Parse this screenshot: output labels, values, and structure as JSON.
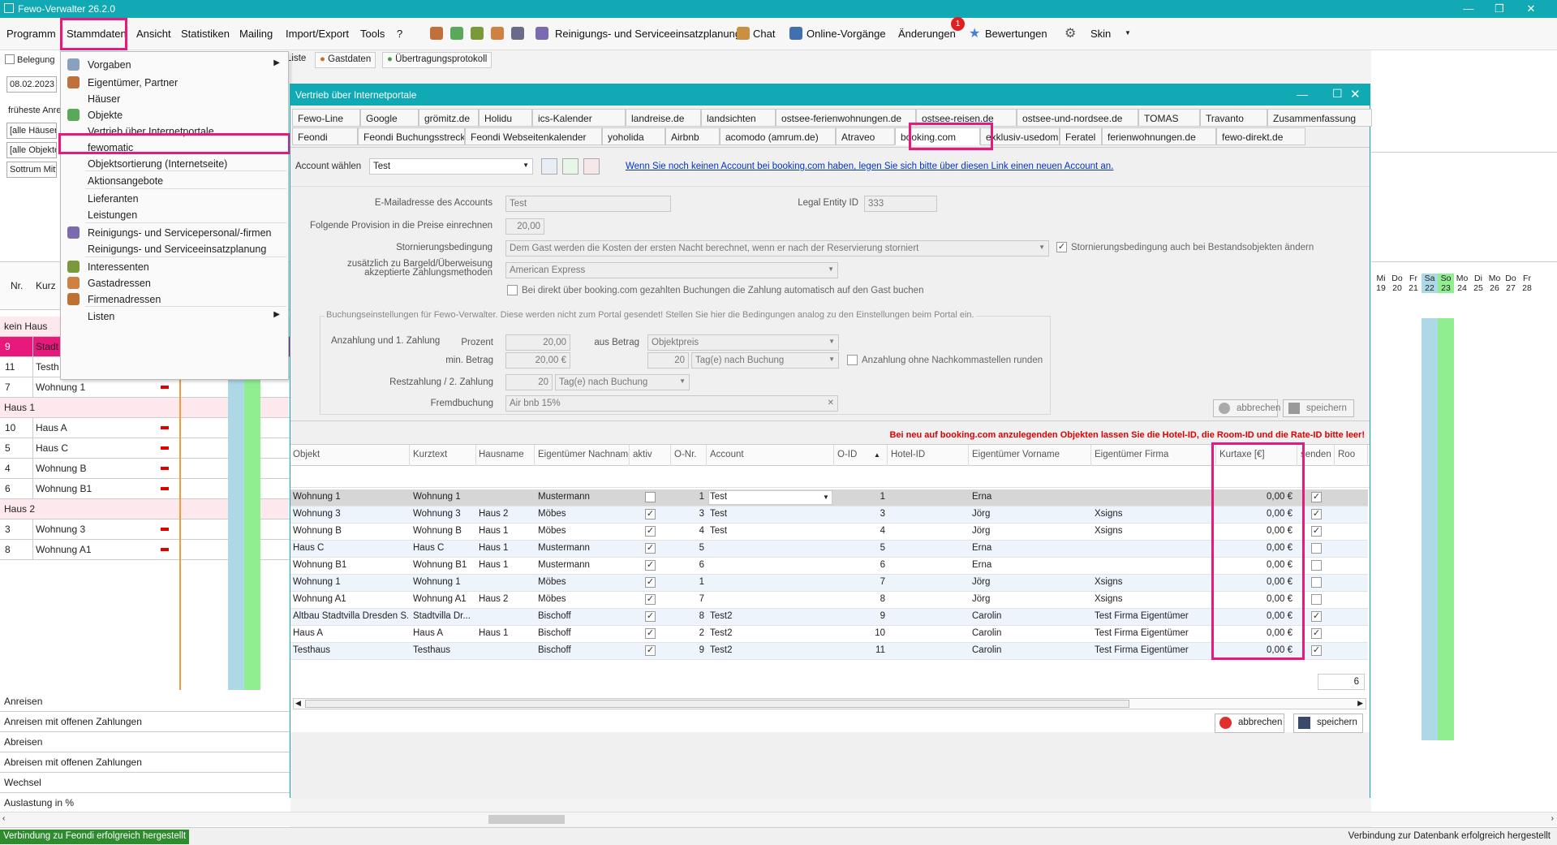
{
  "app": {
    "title": "Fewo-Verwalter 26.2.0"
  },
  "menu": {
    "items": [
      "Programm",
      "Stammdaten",
      "Ansicht",
      "Statistiken",
      "Mailing",
      "Import/Export",
      "Tools",
      "?"
    ],
    "toolbar": {
      "planning": "Reinigungs- und Serviceeinsatzplanung",
      "chat": "Chat",
      "online": "Online-Vorgänge",
      "changes": "Änderungen",
      "changes_badge": "1",
      "reviews": "Bewertungen",
      "skin": "Skin"
    }
  },
  "dropdown": {
    "items": [
      {
        "label": "Vorgaben",
        "arrow": true
      },
      {
        "label": "Eigentümer, Partner"
      },
      {
        "label": "Häuser"
      },
      {
        "label": "Objekte"
      },
      {
        "label": "Vertrieb über Internetportale"
      },
      {
        "label": "fewomatic"
      },
      {
        "label": "Objektsortierung (Internetseite)"
      },
      {
        "label": "Aktionsangebote"
      },
      {
        "label": "Lieferanten"
      },
      {
        "label": "Leistungen"
      },
      {
        "label": "Reinigungs- und Servicepersonal/-firmen"
      },
      {
        "label": "Reinigungs- und Serviceeinsatzplanung"
      },
      {
        "label": "Interessenten"
      },
      {
        "label": "Gastadressen"
      },
      {
        "label": "Firmenadressen"
      },
      {
        "label": "Listen",
        "arrow": true
      }
    ]
  },
  "left": {
    "tab": "Belegung",
    "date": "08.02.2023",
    "earliest": "früheste Anre",
    "filter1": "[alle Häuser]",
    "filter2": "[alle Objekte]",
    "filter3": "Sottrum Mitte",
    "col_nr": "Nr.",
    "col_kurz": "Kurz",
    "rows": [
      {
        "type": "group",
        "label": "kein Haus"
      },
      {
        "type": "item",
        "nr": "9",
        "kurz": "Stadt",
        "hl": true
      },
      {
        "type": "item",
        "nr": "11",
        "kurz": "Testh"
      },
      {
        "type": "item",
        "nr": "7",
        "kurz": "Wohnung 1"
      },
      {
        "type": "group",
        "label": "Haus 1"
      },
      {
        "type": "item",
        "nr": "10",
        "kurz": "Haus A"
      },
      {
        "type": "item",
        "nr": "5",
        "kurz": "Haus C"
      },
      {
        "type": "item",
        "nr": "4",
        "kurz": "Wohnung B"
      },
      {
        "type": "item",
        "nr": "6",
        "kurz": "Wohnung B1"
      },
      {
        "type": "group",
        "label": "Haus 2"
      },
      {
        "type": "item",
        "nr": "3",
        "kurz": "Wohnung 3"
      },
      {
        "type": "item",
        "nr": "8",
        "kurz": "Wohnung A1"
      }
    ],
    "summary": [
      "Anreisen",
      "Anreisen mit offenen Zahlungen",
      "Abreisen",
      "Abreisen mit offenen Zahlungen",
      "Wechsel",
      "Auslastung in %"
    ]
  },
  "bgtabs": [
    "Liste",
    "Gastdaten",
    "Übertragungsprotokoll"
  ],
  "calendar": {
    "days": [
      "Mi",
      "Do",
      "Fr",
      "Sa",
      "So",
      "Mo",
      "Di",
      "Mo",
      "Do",
      "Fr"
    ],
    "dates": [
      "19",
      "20",
      "21",
      "22",
      "23",
      "24",
      "25",
      "26",
      "27",
      "28"
    ]
  },
  "dialog": {
    "title": "Vertrieb über Internetportale",
    "tabs_row1": [
      "Fewo-Line",
      "Google",
      "grömitz.de",
      "Holidu",
      "ics-Kalender",
      "landreise.de",
      "landsichten",
      "ostsee-ferienwohnungen.de",
      "ostsee-reisen.de",
      "ostsee-und-nordsee.de",
      "TOMAS",
      "Travanto",
      "Zusammenfassung"
    ],
    "tabs_row2": [
      "Feondi",
      "Feondi Buchungsstrecke",
      "Feondi Webseitenkalender",
      "yoholida",
      "Airbnb",
      "acomodo (amrum.de)",
      "Atraveo",
      "booking.com",
      "exklusiv-usedom.de",
      "Feratel",
      "ferienwohnungen.de",
      "fewo-direkt.de"
    ],
    "account_label": "Account wählen",
    "account_value": "Test",
    "link": "Wenn Sie noch keinen Account bei booking.com haben, legen Sie sich bitte über diesen Link einen neuen Account an.",
    "email_label": "E-Mailadresse des Accounts",
    "email_value": "Test",
    "legal_label": "Legal Entity ID",
    "legal_value": "333",
    "prov_label": "Folgende Provision in die Preise einrechnen",
    "prov_value": "20,00",
    "storno_label": "Stornierungsbedingung",
    "storno_value": "Dem Gast werden die Kosten der ersten Nacht berechnet, wenn er nach der Reservierung storniert",
    "storno_check": "Stornierungsbedingung auch bei Bestandsobjekten ändern",
    "pay_label1": "zusätzlich zu Bargeld/Überweisung",
    "pay_label2": "akzeptierte Zahlungsmethoden",
    "pay_value": "American Express",
    "direct_check": "Bei direkt über booking.com gezahlten Buchungen die Zahlung automatisch auf den Gast buchen",
    "group_title": "Buchungseinstellungen für Fewo-Verwalter. Diese werden nicht zum Portal gesendet! Stellen Sie hier die Bedingungen analog zu den Einstellungen beim Portal ein.",
    "anz_label": "Anzahlung und 1. Zahlung",
    "prozent_label": "Prozent",
    "prozent_value": "20,00",
    "aus_label": "aus Betrag",
    "aus_value": "Objektpreis",
    "min_label": "min. Betrag",
    "min_value": "20,00 €",
    "days_value": "20",
    "days_unit": "Tag(e) nach Buchung",
    "round_check": "Anzahlung ohne Nachkommastellen runden",
    "rest_label": "Restzahlung / 2. Zahlung",
    "rest_days": "20",
    "rest_unit": "Tag(e) nach Buchung",
    "fremd_label": "Fremdbuchung",
    "fremd_value": "Air bnb 15%",
    "cancel": "abbrechen",
    "save": "speichern",
    "warning": "Bei neu auf booking.com anzulegenden Objekten lassen Sie die Hotel-ID, die Room-ID und die Rate-ID bitte leer!",
    "columns": [
      "Objekt",
      "Kurztext",
      "Hausname",
      "Eigentümer Nachname",
      "aktiv",
      "O-Nr.",
      "Account",
      "O-ID",
      "Hotel-ID",
      "Eigentümer Vorname",
      "Eigentümer Firma",
      "Kurtaxe [€]",
      "senden",
      "Roo"
    ],
    "rows": [
      {
        "objekt": "Wohnung 1",
        "kurz": "Wohnung 1",
        "haus": "",
        "nach": "Mustermann",
        "aktiv": false,
        "onr": "1",
        "account": "Test",
        "oid": "1",
        "vor": "Erna",
        "firma": "",
        "kurtaxe": "0,00 €",
        "senden": true,
        "sel": true
      },
      {
        "objekt": "Wohnung 3",
        "kurz": "Wohnung 3",
        "haus": "Haus 2",
        "nach": "Möbes",
        "aktiv": true,
        "onr": "3",
        "account": "Test",
        "oid": "3",
        "vor": "Jörg",
        "firma": "Xsigns",
        "kurtaxe": "0,00 €",
        "senden": true
      },
      {
        "objekt": "Wohnung B",
        "kurz": "Wohnung B",
        "haus": "Haus 1",
        "nach": "Möbes",
        "aktiv": true,
        "onr": "4",
        "account": "Test",
        "oid": "4",
        "vor": "Jörg",
        "firma": "Xsigns",
        "kurtaxe": "0,00 €",
        "senden": true
      },
      {
        "objekt": "Haus C",
        "kurz": "Haus C",
        "haus": "Haus 1",
        "nach": "Mustermann",
        "aktiv": true,
        "onr": "5",
        "account": "",
        "oid": "5",
        "vor": "Erna",
        "firma": "",
        "kurtaxe": "0,00 €",
        "senden": false
      },
      {
        "objekt": "Wohnung B1",
        "kurz": "Wohnung B1",
        "haus": "Haus 1",
        "nach": "Mustermann",
        "aktiv": true,
        "onr": "6",
        "account": "",
        "oid": "6",
        "vor": "Erna",
        "firma": "",
        "kurtaxe": "0,00 €",
        "senden": false
      },
      {
        "objekt": "Wohnung 1",
        "kurz": "Wohnung 1",
        "haus": "",
        "nach": "Möbes",
        "aktiv": true,
        "onr": "1",
        "account": "",
        "oid": "7",
        "vor": "Jörg",
        "firma": "Xsigns",
        "kurtaxe": "0,00 €",
        "senden": false
      },
      {
        "objekt": "Wohnung A1",
        "kurz": "Wohnung A1",
        "haus": "Haus 2",
        "nach": "Möbes",
        "aktiv": true,
        "onr": "7",
        "account": "",
        "oid": "8",
        "vor": "Jörg",
        "firma": "Xsigns",
        "kurtaxe": "0,00 €",
        "senden": false
      },
      {
        "objekt": "Altbau Stadtvilla Dresden S...",
        "kurz": "Stadtvilla Dr...",
        "haus": "",
        "nach": "Bischoff",
        "aktiv": true,
        "onr": "8",
        "account": "Test2",
        "oid": "9",
        "vor": "Carolin",
        "firma": "Test Firma Eigentümer",
        "kurtaxe": "0,00 €",
        "senden": true
      },
      {
        "objekt": "Haus A",
        "kurz": "Haus A",
        "haus": "Haus 1",
        "nach": "Bischoff",
        "aktiv": true,
        "onr": "2",
        "account": "Test2",
        "oid": "10",
        "vor": "Carolin",
        "firma": "Test Firma Eigentümer",
        "kurtaxe": "0,00 €",
        "senden": true
      },
      {
        "objekt": "Testhaus",
        "kurz": "Testhaus",
        "haus": "",
        "nach": "Bischoff",
        "aktiv": true,
        "onr": "9",
        "account": "Test2",
        "oid": "11",
        "vor": "Carolin",
        "firma": "Test Firma Eigentümer",
        "kurtaxe": "0,00 €",
        "senden": true
      }
    ],
    "count": "6"
  },
  "status": {
    "left": "Verbindung zu Feondi erfolgreich hergestellt",
    "right": "Verbindung zur Datenbank erfolgreich hergestellt"
  },
  "colors": {
    "accent": "#11a9b4",
    "highlight": "#e8197d",
    "warning": "#e00000",
    "green": "#90ee90",
    "blue": "#add8e6"
  }
}
